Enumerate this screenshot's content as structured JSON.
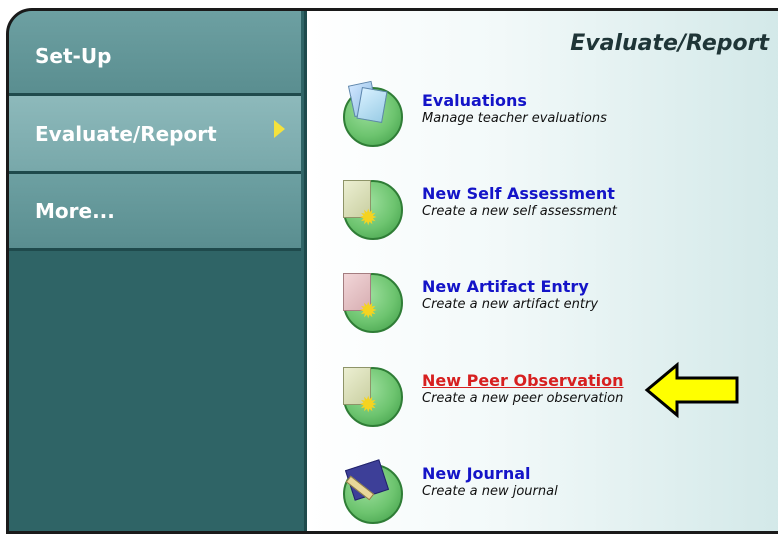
{
  "sidebar": {
    "items": [
      {
        "label": "Set-Up"
      },
      {
        "label": "Evaluate/Report"
      },
      {
        "label": "More..."
      }
    ]
  },
  "main": {
    "title": "Evaluate/Report",
    "links": [
      {
        "label": "Evaluations",
        "desc": "Manage teacher evaluations",
        "icon": "evaluations-icon"
      },
      {
        "label": "New Self Assessment",
        "desc": "Create a new self assessment",
        "icon": "self-assessment-icon"
      },
      {
        "label": "New Artifact Entry",
        "desc": "Create a new artifact entry",
        "icon": "artifact-icon"
      },
      {
        "label": "New Peer Observation",
        "desc": "Create a new peer observation",
        "icon": "peer-observation-icon"
      },
      {
        "label": "New Journal",
        "desc": "Create a new journal",
        "icon": "journal-icon"
      }
    ]
  },
  "colors": {
    "sidebar": "#2f6466",
    "link": "#1414c8",
    "active_link": "#d72020",
    "callout": "#ffff00"
  }
}
